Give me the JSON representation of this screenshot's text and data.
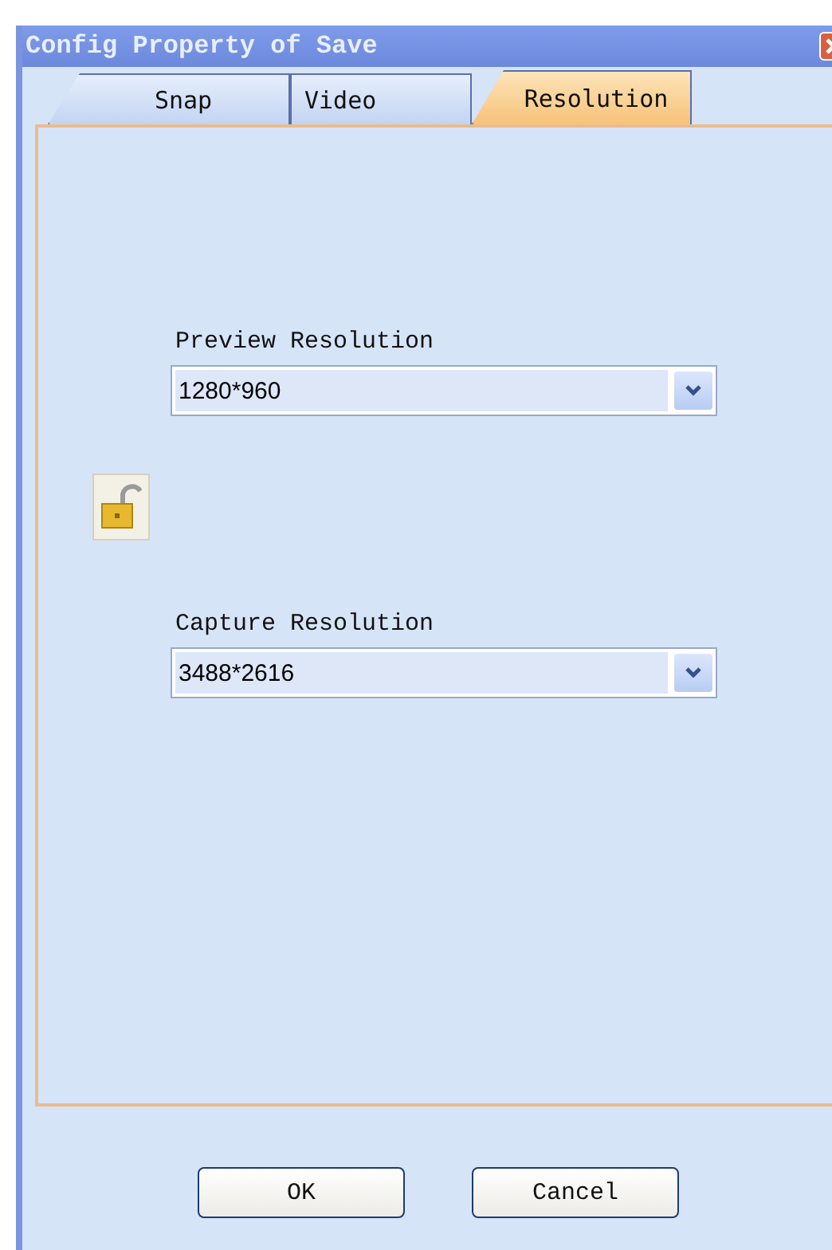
{
  "window": {
    "title": "Config Property of Save"
  },
  "tabs": [
    {
      "label": "Snap",
      "selected": false
    },
    {
      "label": "Video",
      "selected": false
    },
    {
      "label": "Resolution",
      "selected": true
    }
  ],
  "fields": [
    {
      "label": "Preview Resolution",
      "value": "1280*960"
    },
    {
      "label": "Capture Resolution",
      "value": "3488*2616"
    }
  ],
  "lock": {
    "locked": false
  },
  "buttons": [
    "OK",
    "Cancel"
  ]
}
